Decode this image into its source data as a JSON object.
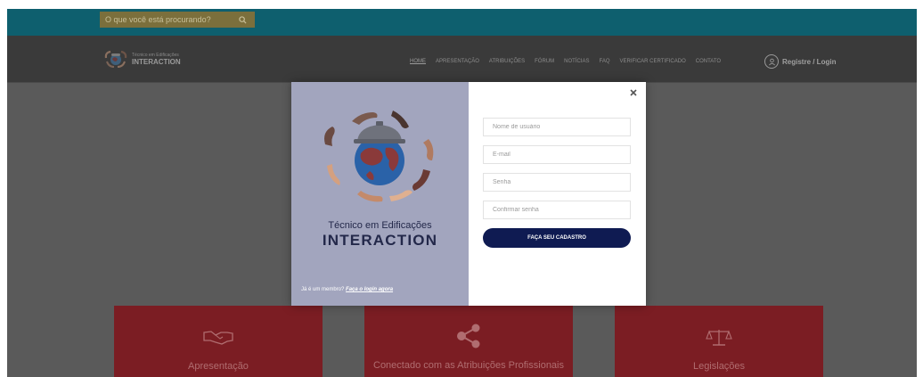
{
  "topbar": {
    "search_placeholder": "O que você está procurando?",
    "search_icon": "search-icon"
  },
  "header": {
    "logo": {
      "subtitle": "Técnico em Edificações",
      "name": "INTERACTION"
    },
    "nav": [
      {
        "label": "HOME",
        "active": true
      },
      {
        "label": "APRESENTAÇÃO"
      },
      {
        "label": "ATRIBUIÇÕES"
      },
      {
        "label": "FÓRUM"
      },
      {
        "label": "NOTÍCIAS"
      },
      {
        "label": "FAQ"
      },
      {
        "label": "VERIFICAR CERTIFICADO"
      },
      {
        "label": "CONTATO"
      }
    ],
    "login": {
      "icon": "user-icon",
      "label": "Registre / Login"
    }
  },
  "modal": {
    "subtitle": "Técnico em Edificações",
    "title": "INTERACTION",
    "member_text": "Já é um membro? ",
    "member_link": "Faça o login agora",
    "fields": {
      "username_placeholder": "Nome de usuário",
      "email_placeholder": "E-mail",
      "password_placeholder": "Senha",
      "confirm_placeholder": "Confirmar senha"
    },
    "submit_label": "FAÇA SEU CADASTRO",
    "close_icon": "close-icon"
  },
  "cards": [
    {
      "title": "Apresentação",
      "icon": "handshake-icon"
    },
    {
      "title": "Conectado com as Atribuições Profissionais",
      "icon": "share-icon"
    },
    {
      "title": "Legislações",
      "icon": "scales-icon"
    }
  ],
  "colors": {
    "topbar": "#0e5f6e",
    "header": "#3a3a3a",
    "overlay": "#5a5a5a",
    "card": "#7b1d23",
    "modal_left": "#a2a5be",
    "modal_title": "#23284a",
    "button": "#0f1b52"
  }
}
